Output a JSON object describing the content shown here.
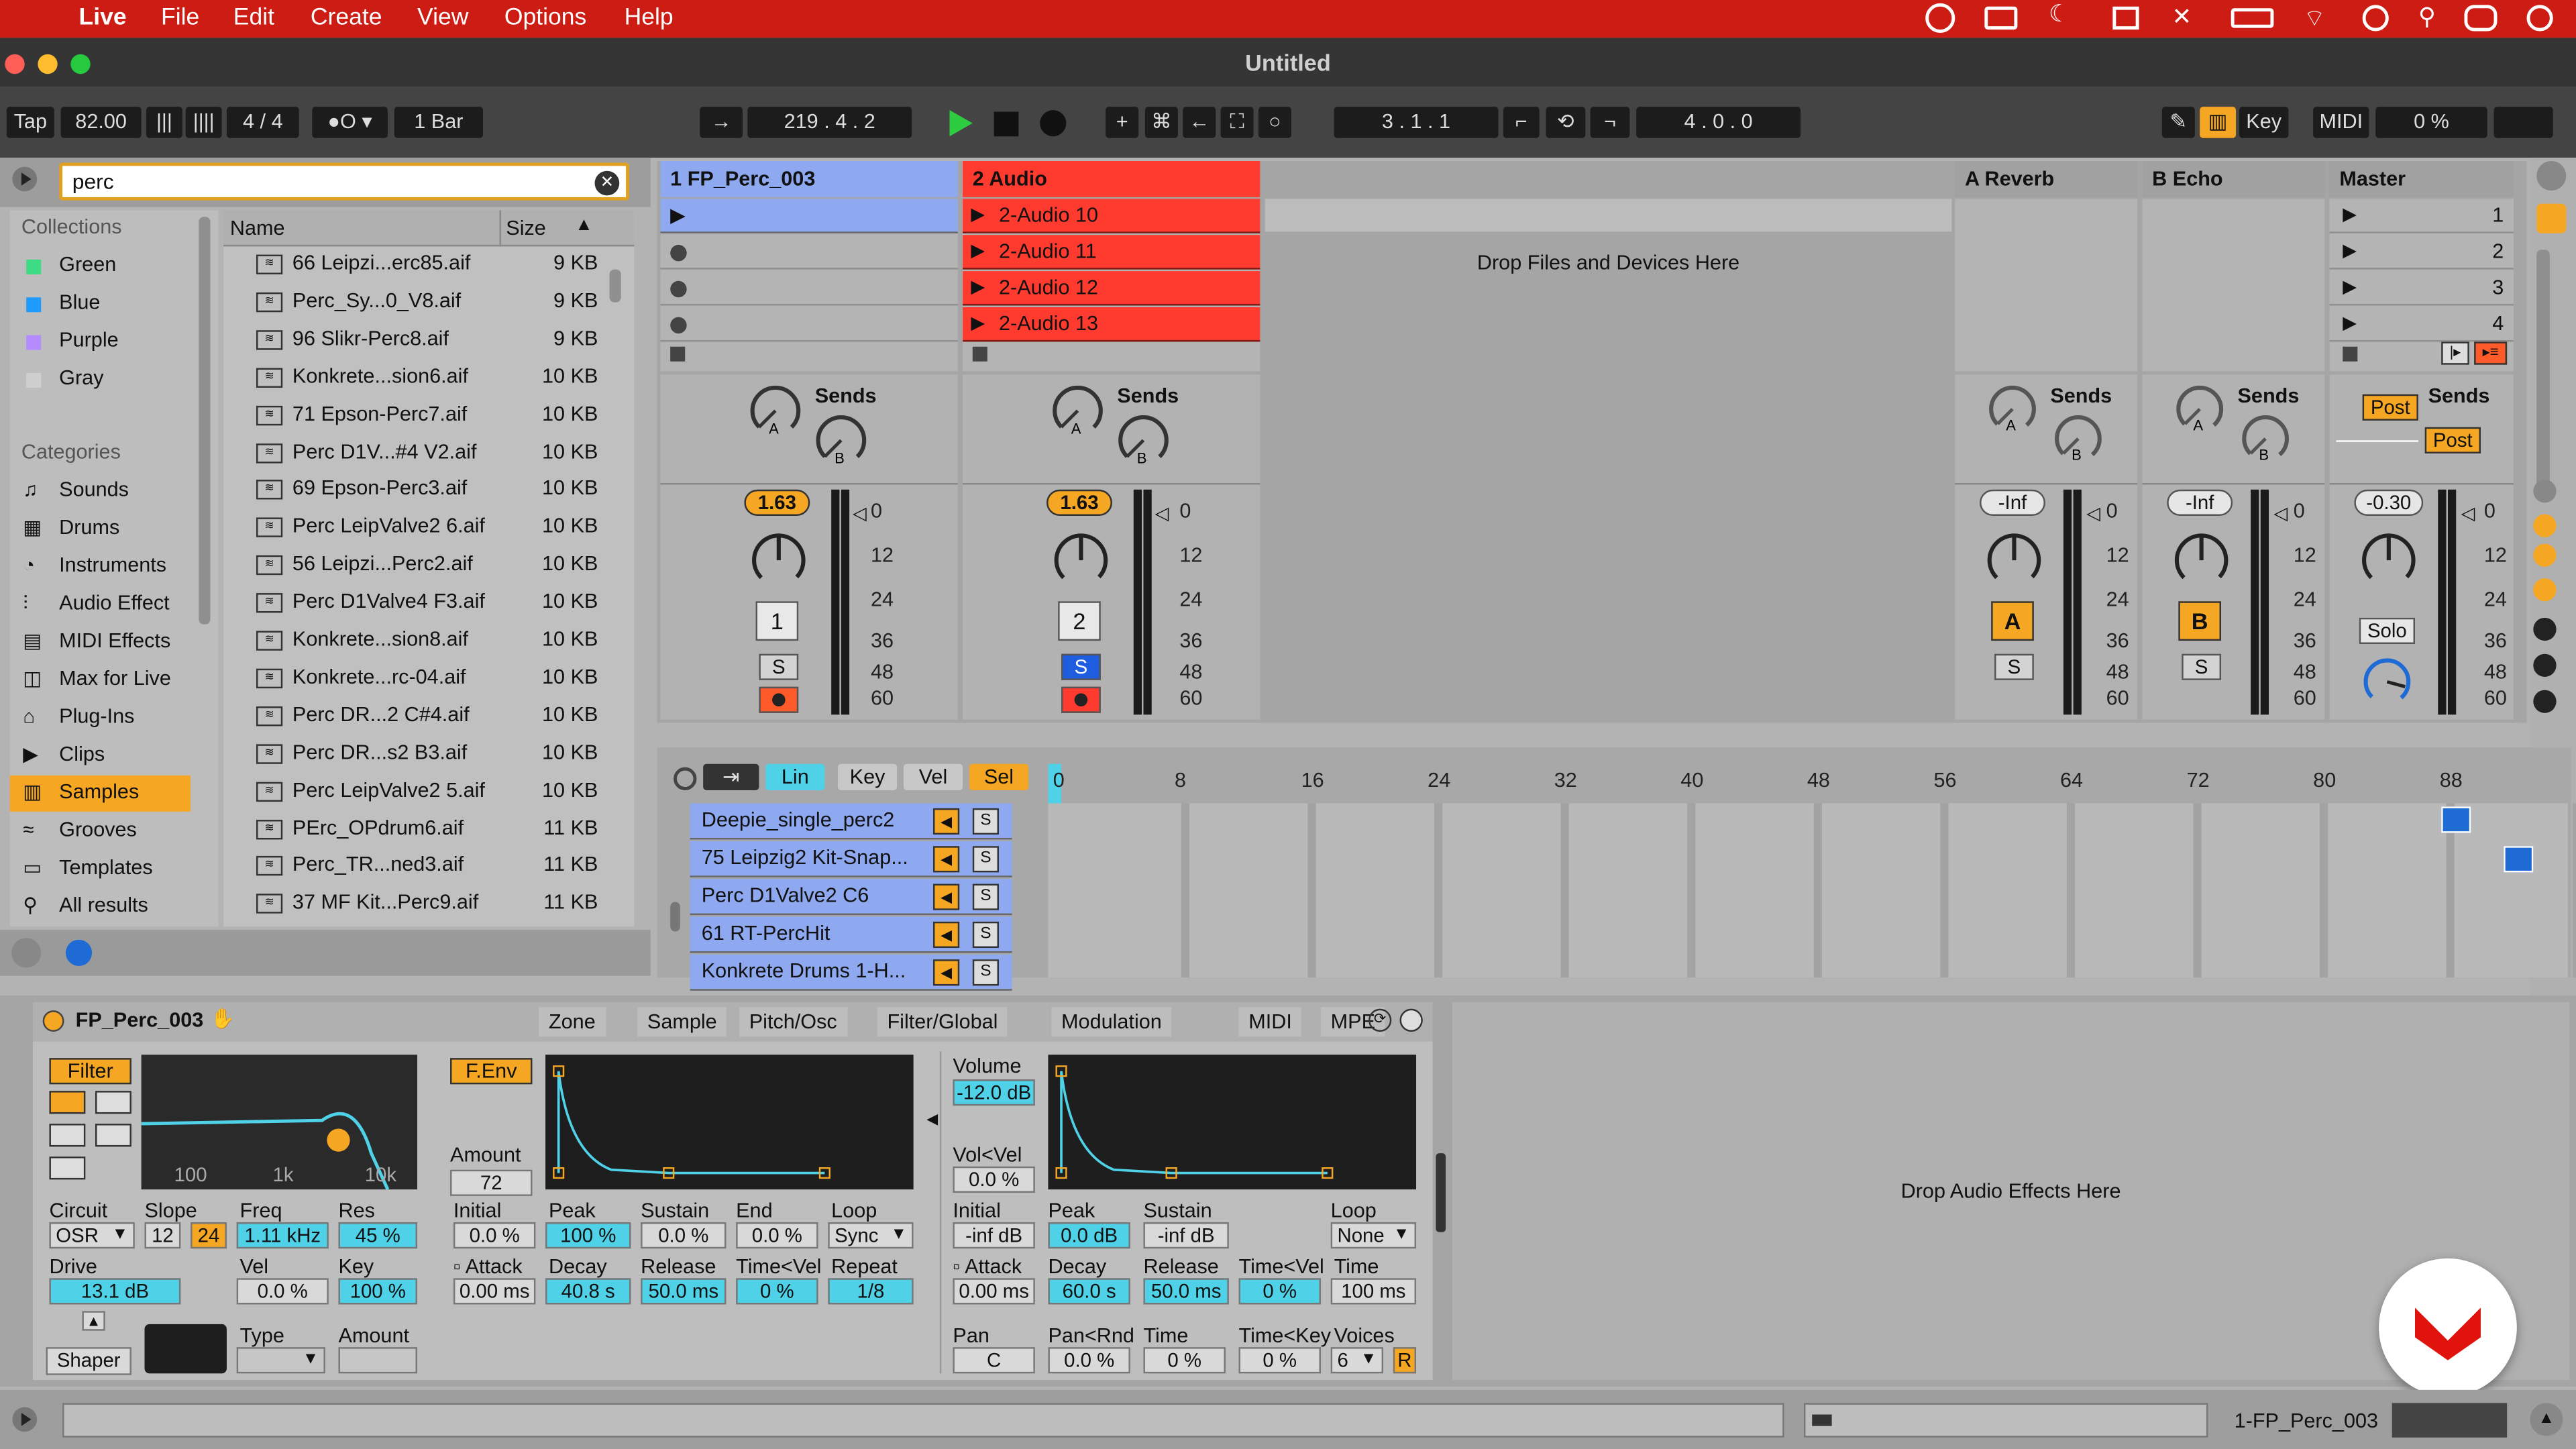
{
  "macbar": {
    "app": "Live",
    "menus": [
      "File",
      "Edit",
      "Create",
      "View",
      "Options",
      "Help"
    ]
  },
  "window": {
    "title": "Untitled"
  },
  "control": {
    "tap": "Tap",
    "tempo": "82.00",
    "sig": "4 / 4",
    "quant": "1 Bar",
    "arr_pos": "219 .   4 .   2",
    "loop_start": "3 .   1 .   1",
    "loop_len": "4 .   0 .   0",
    "key": "Key",
    "midi": "MIDI",
    "cpu": "0 %"
  },
  "browser": {
    "search": "perc",
    "collections_title": "Collections",
    "collections": [
      "Green",
      "Blue",
      "Purple",
      "Gray"
    ],
    "collection_colors": [
      "#3ddc84",
      "#1e9bff",
      "#b58cff",
      "#cfcfcf"
    ],
    "categories_title": "Categories",
    "categories": [
      "Sounds",
      "Drums",
      "Instruments",
      "Audio Effect",
      "MIDI Effects",
      "Max for Live",
      "Plug-Ins",
      "Clips",
      "Samples",
      "Grooves",
      "Templates",
      "All results"
    ],
    "col_name": "Name",
    "col_size": "Size",
    "files": [
      [
        "66 Leipzi...erc85.aif",
        "9 KB"
      ],
      [
        "Perc_Sy...0_V8.aif",
        "9 KB"
      ],
      [
        "96 Slikr-Perc8.aif",
        "9 KB"
      ],
      [
        "Konkrete...sion6.aif",
        "10 KB"
      ],
      [
        "71 Epson-Perc7.aif",
        "10 KB"
      ],
      [
        "Perc D1V...#4 V2.aif",
        "10 KB"
      ],
      [
        "69 Epson-Perc3.aif",
        "10 KB"
      ],
      [
        "Perc LeipValve2 6.aif",
        "10 KB"
      ],
      [
        "56 Leipzi...Perc2.aif",
        "10 KB"
      ],
      [
        "Perc D1Valve4 F3.aif",
        "10 KB"
      ],
      [
        "Konkrete...sion8.aif",
        "10 KB"
      ],
      [
        "Konkrete...rc-04.aif",
        "10 KB"
      ],
      [
        "Perc DR...2 C#4.aif",
        "10 KB"
      ],
      [
        "Perc DR...s2 B3.aif",
        "10 KB"
      ],
      [
        "Perc LeipValve2 5.aif",
        "10 KB"
      ],
      [
        "PErc_OPdrum6.aif",
        "11 KB"
      ],
      [
        "Perc_TR...ned3.aif",
        "11 KB"
      ],
      [
        "37 MF Kit...Perc9.aif",
        "11 KB"
      ]
    ]
  },
  "tracks": {
    "t1": "1 FP_Perc_003",
    "t2": "2 Audio",
    "ra": "A Reverb",
    "rb": "B Echo",
    "master": "Master",
    "clips": [
      "2-Audio 10",
      "2-Audio 11",
      "2-Audio 12",
      "2-Audio 13"
    ],
    "drop": "Drop Files and Devices Here",
    "sends": "Sends",
    "vol1": "1.63",
    "vol2": "1.63",
    "vola": "-Inf",
    "volb": "-Inf",
    "volm": "-0.30",
    "num1": "1",
    "num2": "2",
    "s": "S",
    "a": "A",
    "b": "B",
    "post": "Post",
    "solo": "Solo",
    "scenes": [
      "1",
      "2",
      "3",
      "4"
    ],
    "meter_ticks": [
      "0",
      "12",
      "24",
      "36",
      "48",
      "60"
    ]
  },
  "clipview": {
    "lin": "Lin",
    "key": "Key",
    "vel": "Vel",
    "sel": "Sel",
    "ruler": [
      "0",
      "8",
      "16",
      "24",
      "32",
      "40",
      "48",
      "56",
      "64",
      "72",
      "80",
      "88"
    ],
    "lanes": [
      "Deepie_single_perc2",
      "75 Leipzig2 Kit-Snap...",
      "Perc D1Valve2 C6",
      "61 RT-PercHit",
      "Konkrete Drums 1-H..."
    ]
  },
  "device": {
    "name": "FP_Perc_003",
    "tabs": [
      "Zone",
      "Sample",
      "Pitch/Osc",
      "Filter/Global",
      "Modulation",
      "MIDI",
      "MPE"
    ],
    "filter": "Filter",
    "fenv": "F.Env",
    "amount_label": "Amount",
    "amount": "72",
    "freq_labels": [
      "100",
      "1k",
      "10k"
    ],
    "circuit_l": "Circuit",
    "circuit": "OSR",
    "slope_l": "Slope",
    "slope_a": "12",
    "slope_b": "24",
    "freq_l": "Freq",
    "freq": "1.11 kHz",
    "res_l": "Res",
    "res": "45 %",
    "drive_l": "Drive",
    "drive": "13.1 dB",
    "vel_l": "Vel",
    "vel": "0.0 %",
    "key_l": "Key",
    "key": "100 %",
    "shaper": "Shaper",
    "type_l": "Type",
    "amount2_l": "Amount",
    "fe": {
      "initial_l": "Initial",
      "initial": "0.0 %",
      "peak_l": "Peak",
      "peak": "100 %",
      "sustain_l": "Sustain",
      "sustain": "0.0 %",
      "end_l": "End",
      "end": "0.0 %",
      "loop_l": "Loop",
      "loop": "Sync",
      "attack_l": "Attack",
      "attack": "0.00 ms",
      "decay_l": "Decay",
      "decay": "40.8 s",
      "release_l": "Release",
      "release": "50.0 ms",
      "tvel_l": "Time<Vel",
      "tvel": "0 %",
      "repeat_l": "Repeat",
      "repeat": "1/8"
    },
    "ae": {
      "volume_l": "Volume",
      "volume": "-12.0 dB",
      "volvel_l": "Vol<Vel",
      "volvel": "0.0 %",
      "initial_l": "Initial",
      "initial": "-inf dB",
      "peak_l": "Peak",
      "peak": "0.0 dB",
      "sustain_l": "Sustain",
      "sustain": "-inf dB",
      "loop_l": "Loop",
      "loop": "None",
      "attack_l": "Attack",
      "attack": "0.00 ms",
      "decay_l": "Decay",
      "decay": "60.0 s",
      "release_l": "Release",
      "release": "50.0 ms",
      "tvel_l": "Time<Vel",
      "tvel": "0 %",
      "time_l": "Time",
      "time": "100 ms",
      "pan_l": "Pan",
      "pan": "C",
      "panrnd_l": "Pan<Rnd",
      "panrnd": "0.0 %",
      "time2_l": "Time",
      "time2": "0 %",
      "tkey_l": "Time<Key",
      "tkey": "0 %",
      "voices_l": "Voices",
      "voices": "6",
      "r": "R"
    },
    "drop_fx": "Drop Audio Effects Here"
  },
  "status": {
    "track": "1-FP_Perc_003"
  },
  "colors": {
    "accent": "#f5a623",
    "cyan": "#4fd1e8",
    "clip_red": "#ff3b30",
    "track_blue": "#8ea9f0"
  }
}
